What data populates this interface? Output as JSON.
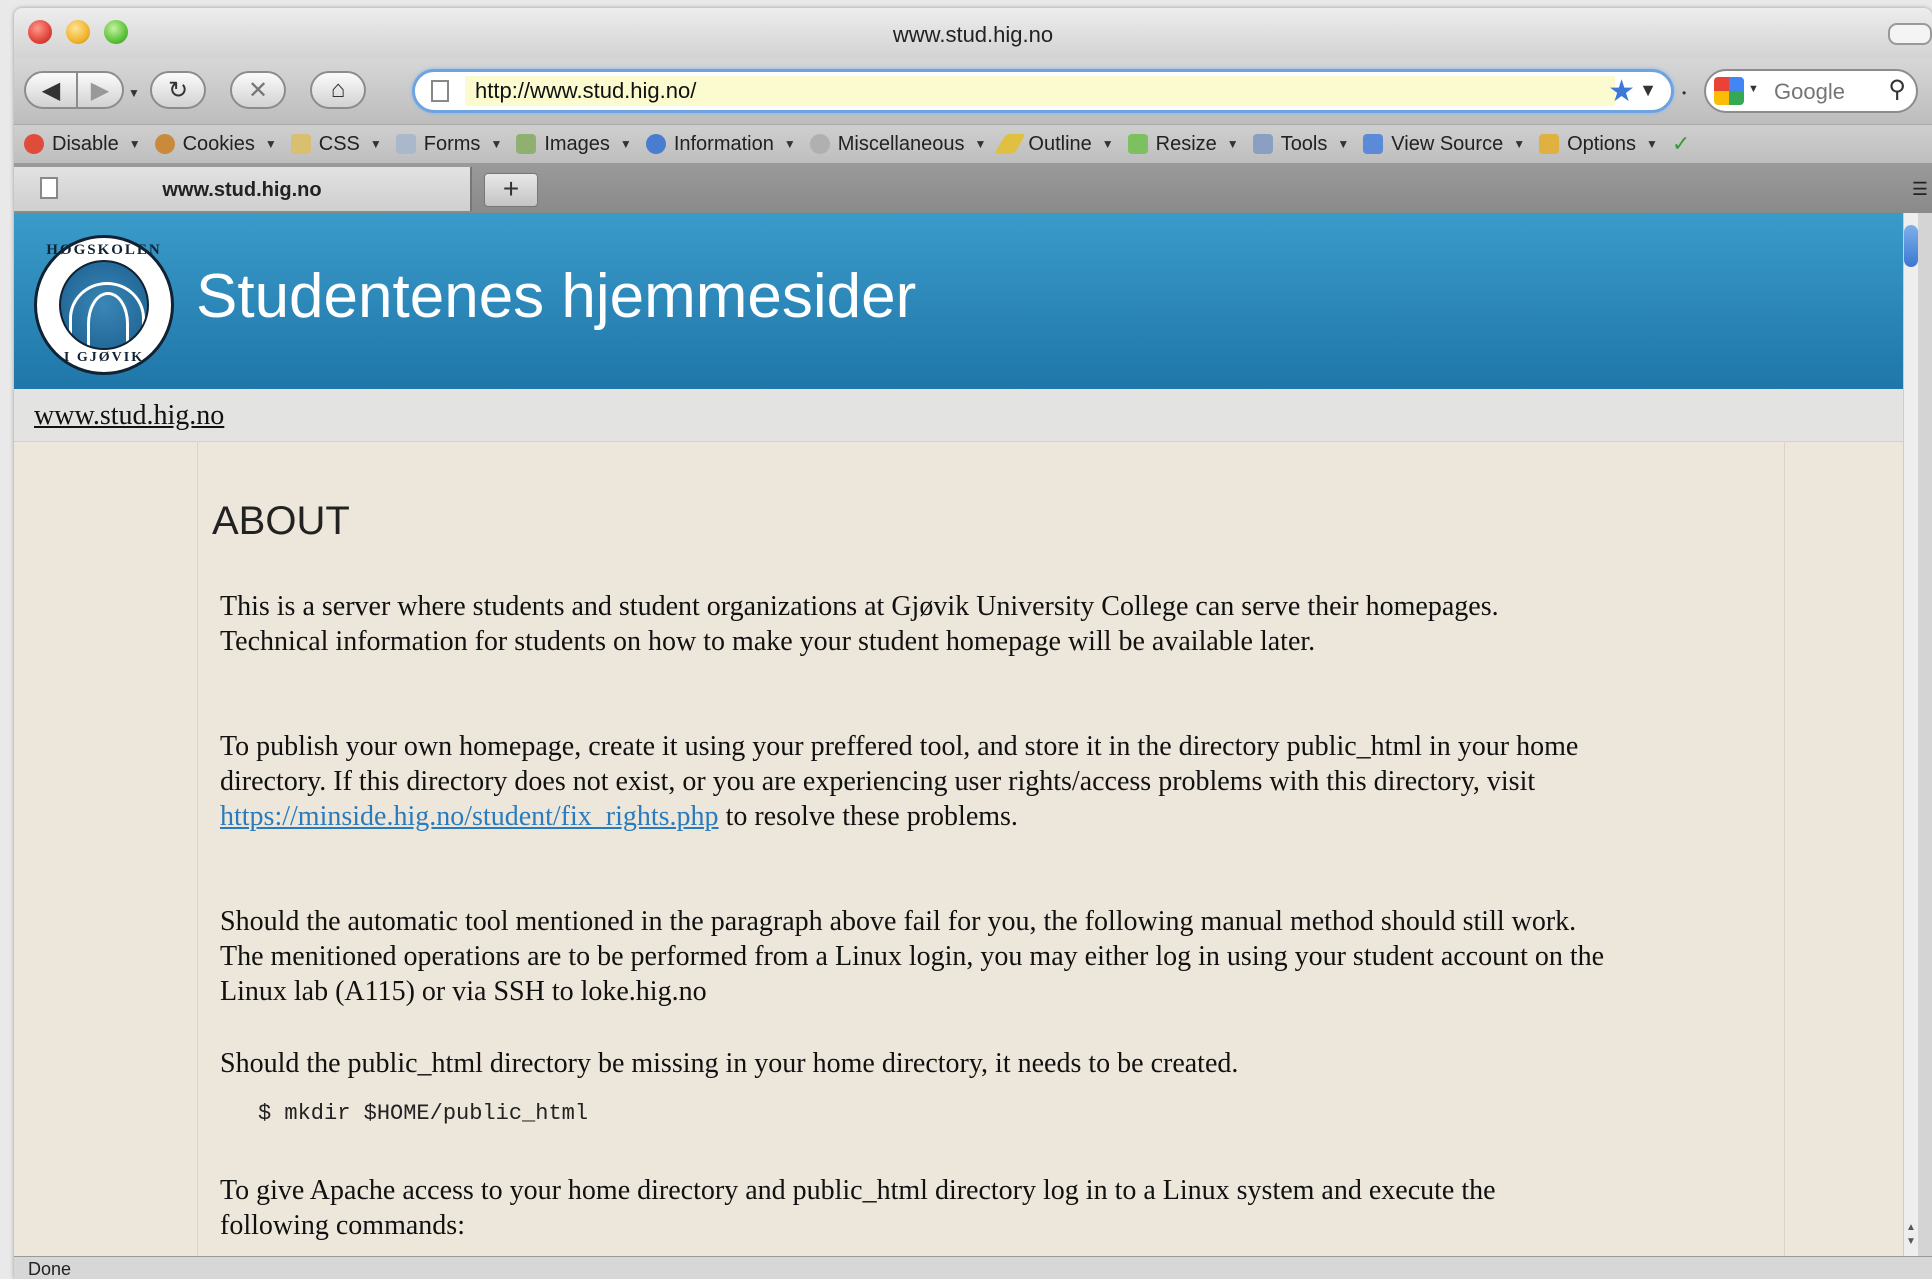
{
  "window": {
    "title": "www.stud.hig.no"
  },
  "nav": {
    "back": "◀",
    "forward": "▶",
    "reload": "↻",
    "stop": "✕",
    "home": "⌂",
    "url": "http://www.stud.hig.no/",
    "search_placeholder": "Google"
  },
  "devbar": {
    "items": [
      {
        "label": "Disable"
      },
      {
        "label": "Cookies"
      },
      {
        "label": "CSS"
      },
      {
        "label": "Forms"
      },
      {
        "label": "Images"
      },
      {
        "label": "Information"
      },
      {
        "label": "Miscellaneous"
      },
      {
        "label": "Outline"
      },
      {
        "label": "Resize"
      },
      {
        "label": "Tools"
      },
      {
        "label": "View Source"
      },
      {
        "label": "Options"
      }
    ]
  },
  "tabs": {
    "active_label": "www.stud.hig.no",
    "new_tab": "+"
  },
  "page": {
    "logo_top": "HØGSKOLEN",
    "logo_bottom": "I GJØVIK",
    "site_title": "Studentenes hjemmesider",
    "breadcrumb": "www.stud.hig.no",
    "heading": "ABOUT",
    "p1": "This is a server where students and student organizations at Gjøvik University College can serve their homepages. Technical information for students on how to make your student homepage will be available later.",
    "p2_before": "To publish your own homepage, create it using your preffered tool, and store it in the directory public_html in your home directory. If this directory does not exist, or you are experiencing user rights/access problems with this directory, visit ",
    "p2_link": "https://minside.hig.no/student/fix_rights.php",
    "p2_after": " to resolve these problems.",
    "p3": "Should the automatic tool mentioned in the paragraph above fail for you, the following manual method should still work. The menitioned operations are to be performed from a Linux login, you may either log in using your student account on the Linux lab (A115) or via SSH to loke.hig.no",
    "p4": "Should the public_html directory be missing in your home directory, it needs to be created.",
    "code1": "$ mkdir $HOME/public_html",
    "p5": "To give Apache access to your home directory and public_html directory log in to a Linux system and execute the following commands:"
  },
  "status": {
    "text": "Done"
  }
}
